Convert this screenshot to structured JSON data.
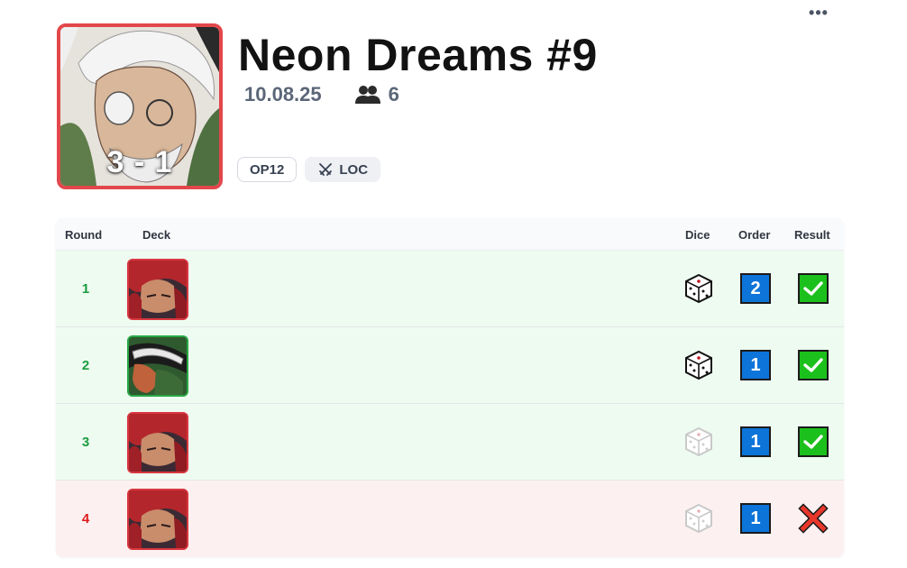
{
  "header": {
    "title": "Neon Dreams #9",
    "date": "10.08.25",
    "players": "6",
    "players_icon": "users-icon",
    "score": "3 - 1",
    "menu_icon": "more-dots-icon",
    "more_glyph": "•••"
  },
  "tags": [
    {
      "label": "OP12",
      "style": "outline"
    },
    {
      "label": "LOC",
      "icon": "crossed-swords-icon",
      "style": "filled"
    }
  ],
  "table": {
    "headers": {
      "round": "Round",
      "deck": "Deck",
      "dice": "Dice",
      "order": "Order",
      "result": "Result"
    },
    "rows": [
      {
        "round": "1",
        "deck": "red-haired-leader",
        "dice": "won",
        "order": "2",
        "result": "win"
      },
      {
        "round": "2",
        "deck": "green-leader",
        "dice": "won",
        "order": "1",
        "result": "win"
      },
      {
        "round": "3",
        "deck": "red-haired-leader",
        "dice": "lost",
        "order": "1",
        "result": "win"
      },
      {
        "round": "4",
        "deck": "red-haired-leader",
        "dice": "lost",
        "order": "1",
        "result": "loss"
      }
    ]
  },
  "colors": {
    "avatar_border": "#e2474b",
    "win_bg": "#eefbf1",
    "loss_bg": "#fdf0f0",
    "win_text": "#1a9c3e",
    "loss_text": "#dd1b1b",
    "order_blue": "#0d74d9",
    "check_green": "#1cc01c",
    "cross_red": "#e8372a"
  }
}
